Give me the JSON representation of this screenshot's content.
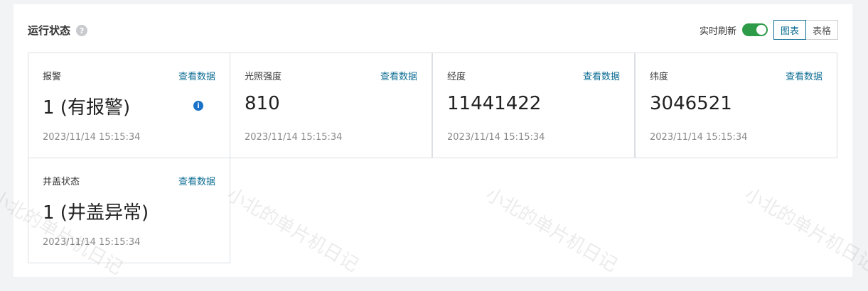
{
  "header": {
    "title": "运行状态",
    "help_icon": "?",
    "realtime_label": "实时刷新",
    "realtime_on": true,
    "view_chart": "图表",
    "view_table": "表格"
  },
  "cards": [
    {
      "label": "报警",
      "link": "查看数据",
      "value": "1 (有报警)",
      "time": "2023/11/14 15:15:34",
      "info_icon": "i"
    },
    {
      "label": "光照强度",
      "link": "查看数据",
      "value": "810",
      "time": "2023/11/14 15:15:34"
    },
    {
      "label": "经度",
      "link": "查看数据",
      "value": "11441422",
      "time": "2023/11/14 15:15:34"
    },
    {
      "label": "纬度",
      "link": "查看数据",
      "value": "3046521",
      "time": "2023/11/14 15:15:34"
    },
    {
      "label": "井盖状态",
      "link": "查看数据",
      "value": "1 (井盖异常)",
      "time": "2023/11/14 15:15:34"
    }
  ],
  "watermark": "小北的单片机日记",
  "colors": {
    "accent": "#0f6e94",
    "toggle_on": "#2e9b49",
    "info": "#1a73c8"
  }
}
